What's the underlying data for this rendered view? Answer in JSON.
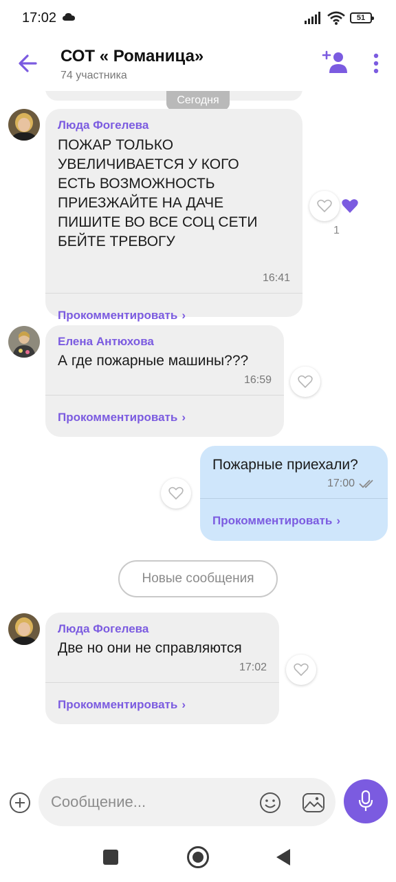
{
  "status_bar": {
    "time": "17:02",
    "battery": "51"
  },
  "header": {
    "title": "СОТ « Романица»",
    "subtitle": "74 участника"
  },
  "date_separator": "Сегодня",
  "messages": [
    {
      "sender": "Люда Фогелева",
      "lines": [
        "ПОЖАР ТОЛЬКО",
        "УВЕЛИЧИВАЕТСЯ У КОГО",
        "ЕСТЬ ВОЗМОЖНОСТЬ",
        "ПРИЕЗЖАЙТЕ НА ДАЧЕ",
        "ПИШИТЕ ВО ВСЕ СОЦ  СЕТИ",
        "БЕЙТЕ ТРЕВОГУ"
      ],
      "time": "16:41",
      "comment": "Прокомментировать",
      "likes": "1"
    },
    {
      "sender": "Елена  Антюхова",
      "text": "А где пожарные машины???",
      "time": "16:59",
      "comment": "Прокомментировать"
    },
    {
      "text": "Пожарные приехали?",
      "time": "17:00",
      "comment": "Прокомментировать"
    },
    {
      "sender": "Люда Фогелева",
      "text": "Две но они не справляются",
      "time": "17:02",
      "comment": "Прокомментировать"
    }
  ],
  "new_messages_label": "Новые сообщения",
  "composer": {
    "placeholder": "Сообщение..."
  },
  "colors": {
    "accent": "#7b5be0",
    "incoming_bubble": "#efefef",
    "outgoing_bubble": "#cfe6fb"
  },
  "icons": [
    "back-arrow-icon",
    "add-member-icon",
    "more-vertical-icon",
    "heart-icon",
    "plus-circle-icon",
    "emoji-icon",
    "sticker-icon",
    "microphone-icon",
    "double-check-icon"
  ]
}
